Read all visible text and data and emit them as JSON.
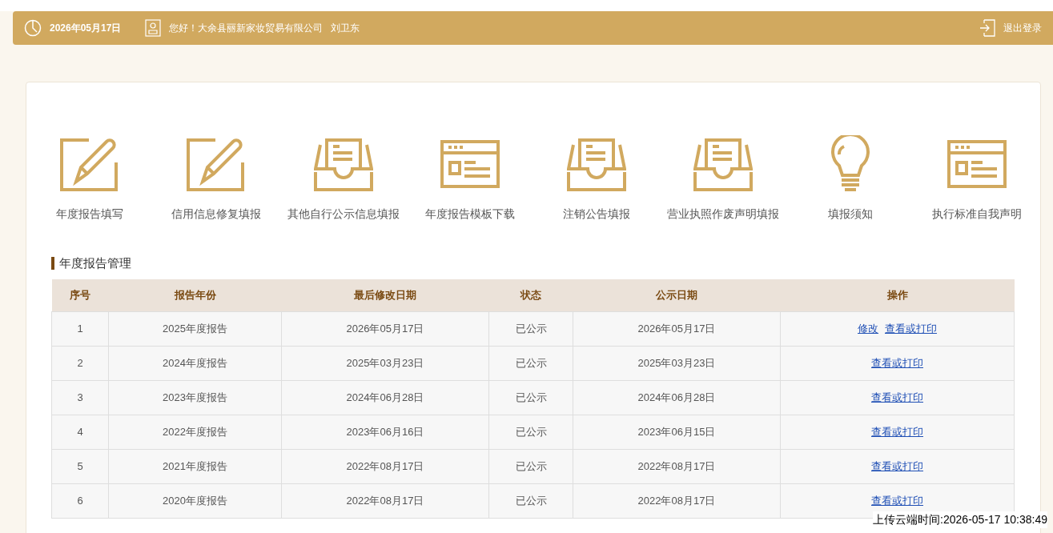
{
  "header": {
    "date": "2026年05月17日",
    "greeting": "您好！大余县丽新家妆贸易有限公司",
    "user": "刘卫东",
    "logout": "退出登录"
  },
  "menu": [
    {
      "kind": "edit",
      "label": "年度报告填写"
    },
    {
      "kind": "edit",
      "label": "信用信息修复填报"
    },
    {
      "kind": "inbox",
      "label": "其他自行公示信息填报"
    },
    {
      "kind": "template",
      "label": "年度报告模板下载"
    },
    {
      "kind": "inbox",
      "label": "注销公告填报"
    },
    {
      "kind": "inbox",
      "label": "营业执照作废声明填报"
    },
    {
      "kind": "bulb",
      "label": "填报须知"
    },
    {
      "kind": "template",
      "label": "执行标准自我声明"
    }
  ],
  "section_title": "年度报告管理",
  "table": {
    "columns": [
      "序号",
      "报告年份",
      "最后修改日期",
      "状态",
      "公示日期",
      "操作"
    ],
    "rows": [
      {
        "cells": [
          "1",
          "2025年度报告",
          "2026年05月17日",
          "已公示",
          "2026年05月17日"
        ],
        "actions": [
          "修改",
          "查看或打印"
        ]
      },
      {
        "cells": [
          "2",
          "2024年度报告",
          "2025年03月23日",
          "已公示",
          "2025年03月23日"
        ],
        "actions": [
          "查看或打印"
        ]
      },
      {
        "cells": [
          "3",
          "2023年度报告",
          "2024年06月28日",
          "已公示",
          "2024年06月28日"
        ],
        "actions": [
          "查看或打印"
        ]
      },
      {
        "cells": [
          "4",
          "2022年度报告",
          "2023年06月16日",
          "已公示",
          "2023年06月15日"
        ],
        "actions": [
          "查看或打印"
        ]
      },
      {
        "cells": [
          "5",
          "2021年度报告",
          "2022年08月17日",
          "已公示",
          "2022年08月17日"
        ],
        "actions": [
          "查看或打印"
        ]
      },
      {
        "cells": [
          "6",
          "2020年度报告",
          "2022年08月17日",
          "已公示",
          "2022年08月17日"
        ],
        "actions": [
          "查看或打印"
        ]
      }
    ]
  },
  "upload_time": "上传云端时间:2026-05-17 10:38:49"
}
